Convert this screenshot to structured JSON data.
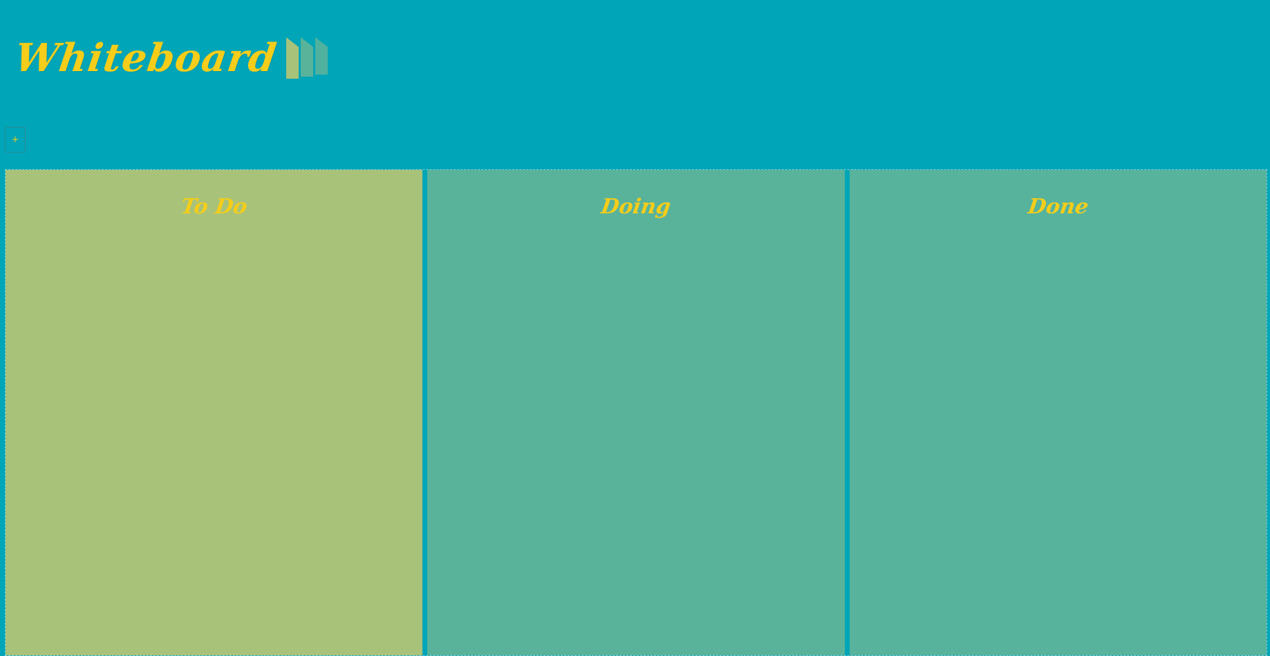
{
  "app": {
    "title": "Whiteboard",
    "logo_icon": "whiteboard-columns-icon"
  },
  "toolbar": {
    "add_label": "+"
  },
  "columns": [
    {
      "title": "To Do",
      "color": "#a8c27a"
    },
    {
      "title": "Doing",
      "color": "#59b39b"
    },
    {
      "title": "Done",
      "color": "#57b39c"
    }
  ],
  "colors": {
    "background": "#00a5b7",
    "accent": "#f5cd1a"
  }
}
